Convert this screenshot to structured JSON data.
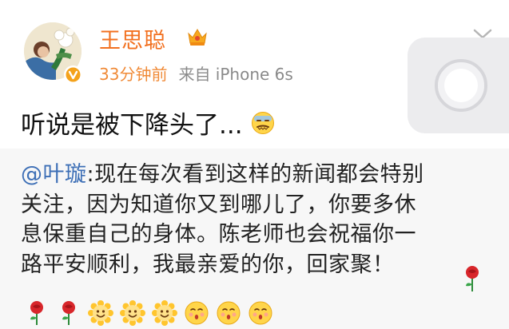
{
  "post": {
    "username": "王思聪",
    "time": "33分钟前",
    "source": "来自 iPhone 6s",
    "text": "听说是被下降头了...",
    "icons": [
      "avatar",
      "verified-badge-icon",
      "crown-icon",
      "chevron-down-icon",
      "embarrassed-emoji-icon"
    ]
  },
  "comment": {
    "mention": "@叶璇",
    "lines": [
      ":现在每次看到这样的新闻都会特别",
      "关注，因为知道你又到哪儿了，你要多休",
      "息保重自己的身体。陈老师也会祝福你一",
      "路平安顺利，我最亲爱的你，回家聚！"
    ],
    "emojis": [
      "rose-icon",
      "rose-icon",
      "rose-icon",
      "flower-face-icon",
      "flower-face-icon",
      "flower-face-icon",
      "kiss-face-icon",
      "kiss-face-icon",
      "kiss-face-icon"
    ]
  },
  "colors": {
    "username": "#f2701f",
    "time": "#f08a37",
    "mention": "#3d6fb6",
    "comment_bg": "#f7f7f7"
  }
}
